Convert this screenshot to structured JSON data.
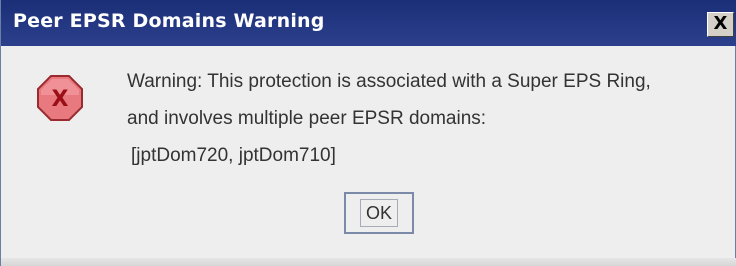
{
  "window": {
    "title": "Peer EPSR Domains Warning",
    "close_label": "X"
  },
  "icon": {
    "type": "error-icon",
    "glyph": "X",
    "fill_color": "#e8797f",
    "border_color": "#9a2a30",
    "glyph_color": "#9a1016"
  },
  "message": {
    "lines": [
      "Warning: This protection is associated with a Super EPS Ring,",
      "and involves multiple peer EPSR domains:",
      " [jptDom720, jptDom710]"
    ]
  },
  "buttons": {
    "ok_label": "OK"
  },
  "colors": {
    "title_bar": "#1b2f78",
    "background": "#eeeeee",
    "text": "#333333"
  }
}
